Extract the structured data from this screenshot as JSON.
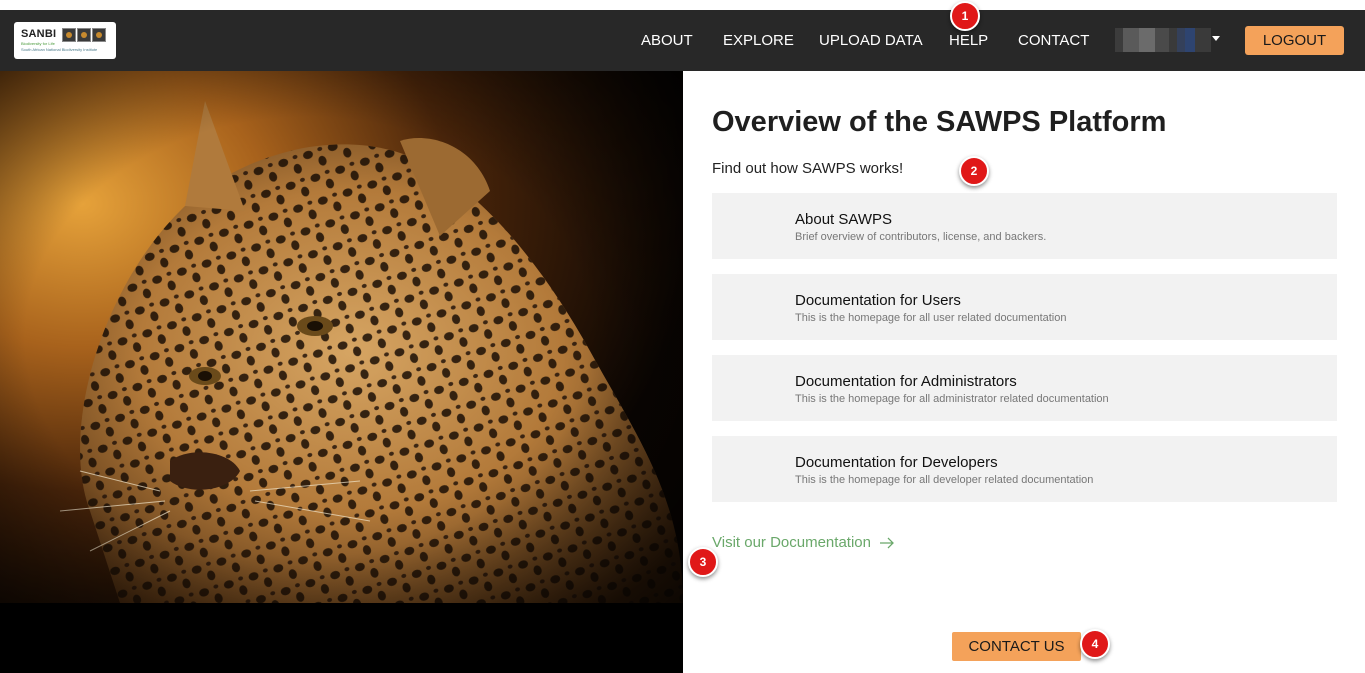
{
  "header": {
    "logo": {
      "name": "SANBI",
      "tagline": "Biodiversity for Life",
      "org": "South African National Biodiversity Institute"
    },
    "nav": [
      {
        "label": "ABOUT"
      },
      {
        "label": "EXPLORE"
      },
      {
        "label": "UPLOAD DATA"
      },
      {
        "label": "HELP"
      },
      {
        "label": "CONTACT"
      }
    ],
    "logout_label": "LOGOUT"
  },
  "main": {
    "title": "Overview of the SAWPS Platform",
    "subtitle": "Find out how SAWPS works!",
    "cards": [
      {
        "title": "About SAWPS",
        "description": "Brief overview of contributors, license, and backers."
      },
      {
        "title": "Documentation for Users",
        "description": "This is the homepage for all user related documentation"
      },
      {
        "title": "Documentation for Administrators",
        "description": "This is the homepage for all administrator related documentation"
      },
      {
        "title": "Documentation for Developers",
        "description": "This is the homepage for all developer related documentation"
      }
    ],
    "doc_link_label": "Visit our Documentation",
    "contact_button_label": "CONTACT US"
  },
  "annotations": [
    "1",
    "2",
    "3",
    "4"
  ],
  "colors": {
    "navbar": "#282828",
    "accent": "#f4a25a",
    "link": "#6aa86a",
    "card": "#f2f2f2",
    "badge": "#e01818"
  }
}
